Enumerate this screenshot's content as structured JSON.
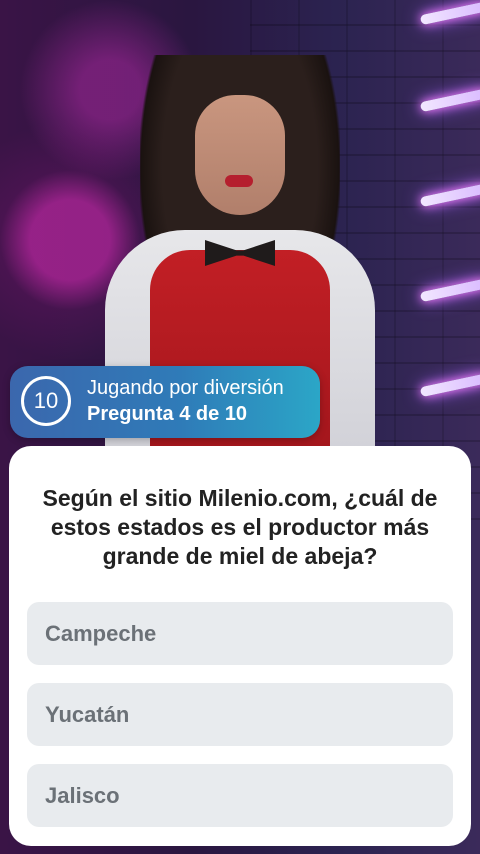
{
  "status": {
    "timer": "10",
    "mode": "Jugando por diversión",
    "progress": "Pregunta 4 de 10"
  },
  "question": {
    "text": "Según el sitio Milenio.com, ¿cuál de estos estados es el productor más grande de miel de abeja?"
  },
  "answers": [
    {
      "label": "Campeche"
    },
    {
      "label": "Yucatán"
    },
    {
      "label": "Jalisco"
    }
  ],
  "colors": {
    "pill_start": "#3b67ad",
    "pill_end": "#2ba6c7",
    "answer_bg": "#e8ebee",
    "answer_text": "#6b7177",
    "question_text": "#222222"
  }
}
